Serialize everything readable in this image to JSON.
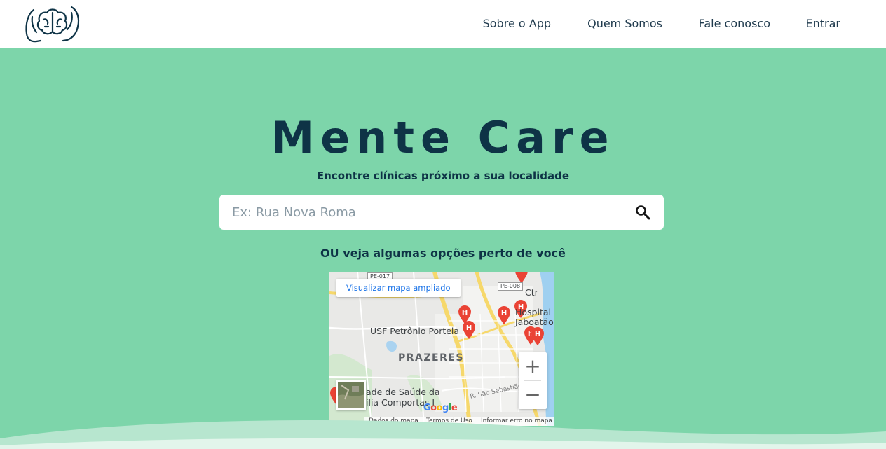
{
  "header": {
    "logo_name": "brain-hands-logo",
    "nav": [
      {
        "label": "Sobre o App"
      },
      {
        "label": "Quem Somos"
      },
      {
        "label": "Fale conosco"
      },
      {
        "label": "Entrar"
      }
    ]
  },
  "hero": {
    "title": "Mente Care",
    "subtitle": "Encontre clínicas próximo a sua localidade",
    "search": {
      "placeholder": "Ex: Rua Nova Roma",
      "value": "",
      "icon": "search-icon"
    },
    "alt_text": "OU veja algumas opções perto de você"
  },
  "map": {
    "view_larger": "Visualizar mapa ampliado",
    "labels": {
      "usf": "USF Petrônio Portela",
      "prazeres": "PRAZERES",
      "ctr": "Ctr",
      "hospital": "Hospital e",
      "jaboatao": "Jaboatão",
      "saude": "ade de Saúde da",
      "familia": "ília Comportas I",
      "street": "R. São Sebastião",
      "pe017": "PE-017",
      "pe008": "PE-008"
    },
    "zoom_in": "+",
    "zoom_out": "−",
    "google": "Google",
    "attribution": {
      "data": "Dados do mapa",
      "terms": "Termos de Uso",
      "report": "Informar erro no mapa"
    }
  },
  "colors": {
    "background": "#7dd5aa",
    "primary_text": "#0e3346",
    "pin": "#ea4335"
  }
}
